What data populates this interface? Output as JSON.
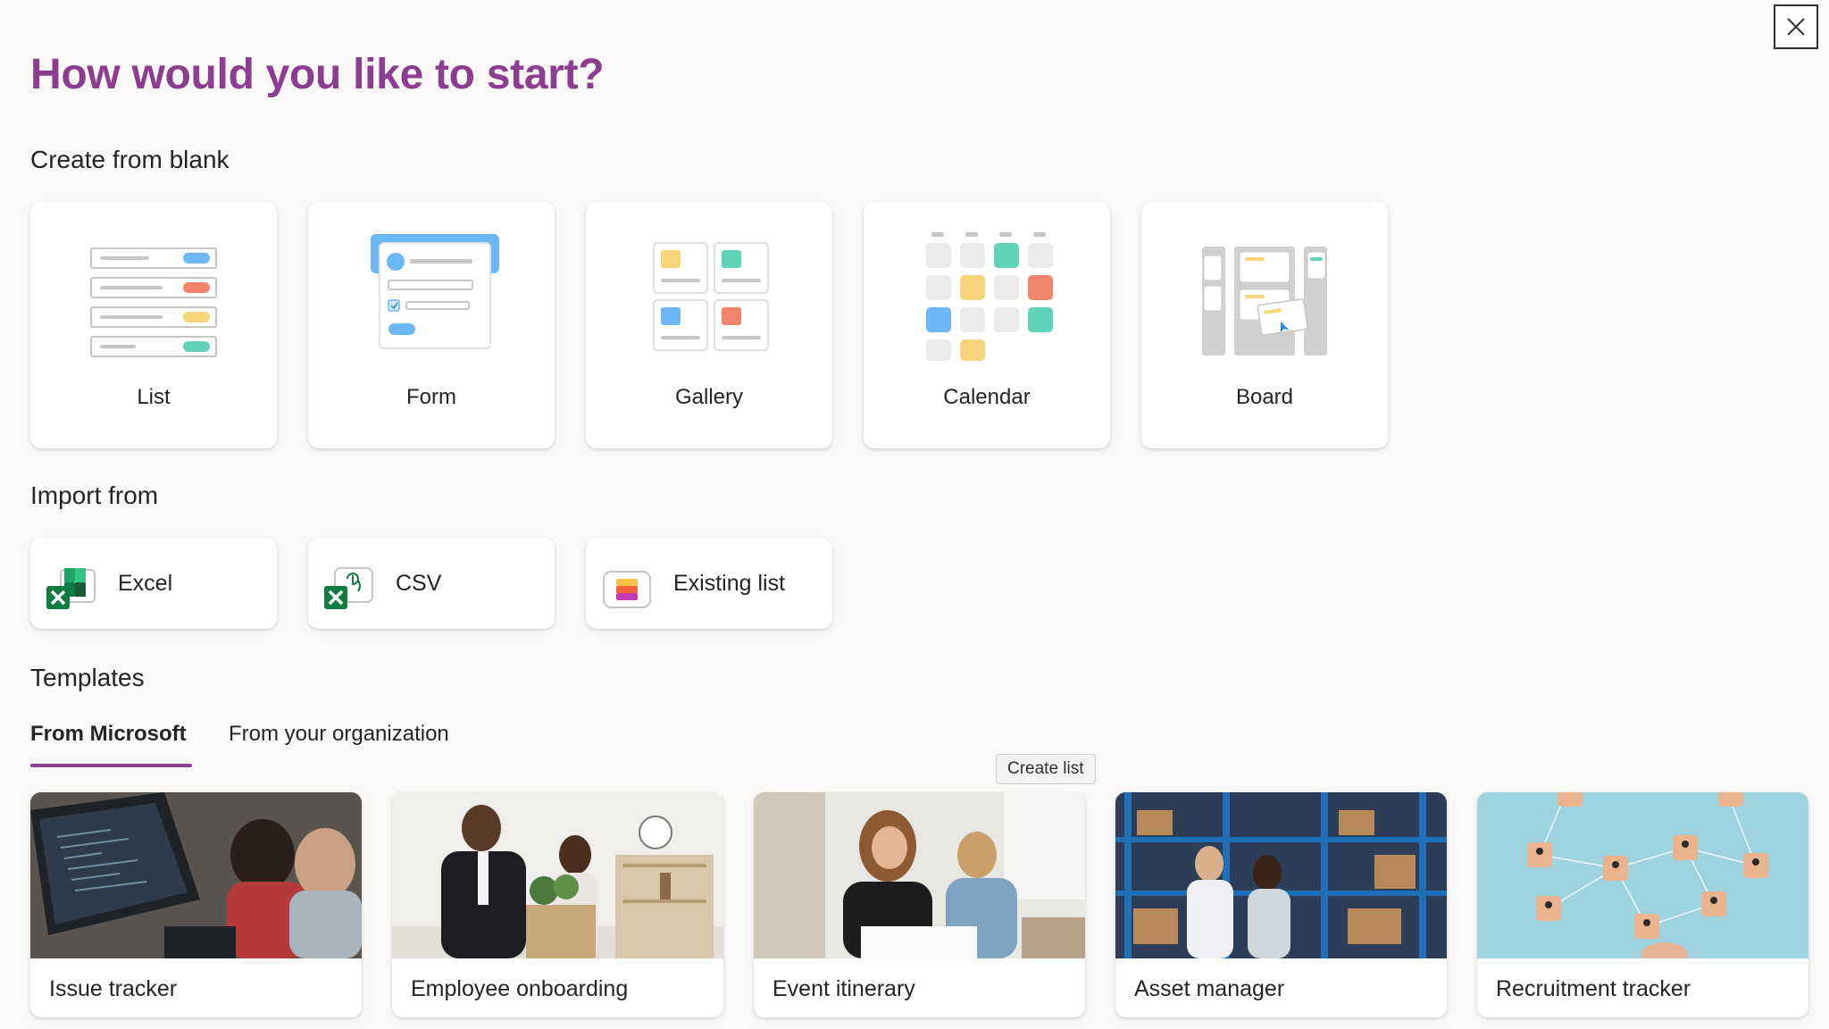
{
  "dialog": {
    "title": "How would you like to start?",
    "close_icon": "close-icon"
  },
  "blank": {
    "heading": "Create from blank",
    "items": [
      {
        "label": "List",
        "icon": "list-illustration"
      },
      {
        "label": "Form",
        "icon": "form-illustration"
      },
      {
        "label": "Gallery",
        "icon": "gallery-illustration"
      },
      {
        "label": "Calendar",
        "icon": "calendar-illustration"
      },
      {
        "label": "Board",
        "icon": "board-illustration"
      }
    ]
  },
  "import": {
    "heading": "Import from",
    "items": [
      {
        "label": "Excel",
        "icon": "excel-icon"
      },
      {
        "label": "CSV",
        "icon": "csv-icon"
      },
      {
        "label": "Existing list",
        "icon": "existing-list-icon"
      }
    ]
  },
  "templates": {
    "heading": "Templates",
    "tabs": [
      {
        "label": "From Microsoft",
        "selected": true
      },
      {
        "label": "From your organization",
        "selected": false
      }
    ],
    "tooltip": "Create list",
    "items": [
      {
        "label": "Issue tracker"
      },
      {
        "label": "Employee onboarding"
      },
      {
        "label": "Event itinerary"
      },
      {
        "label": "Asset manager"
      },
      {
        "label": "Recruitment tracker"
      }
    ]
  },
  "colors": {
    "accent": "#8c3d8f",
    "blue": "#6cb8f6",
    "red": "#f2836b",
    "yellow": "#f7d57b",
    "teal": "#5fd4b8",
    "excel_green": "#107c41"
  }
}
